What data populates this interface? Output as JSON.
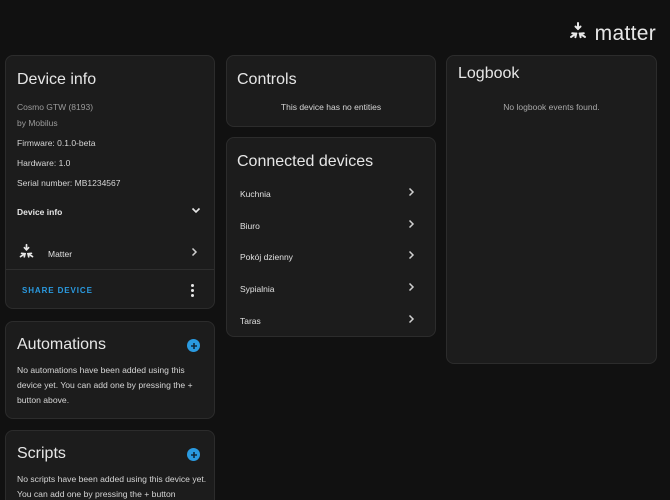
{
  "brand": {
    "name": "matter"
  },
  "device_info": {
    "title": "Device info",
    "model": "Cosmo GTW (8193)",
    "manufacturer": "by Mobilus",
    "firmware": "Firmware: 0.1.0-beta",
    "hardware": "Hardware: 1.0",
    "serial": "Serial number: MB1234567",
    "section_label": "Device info",
    "integration": "Matter",
    "share_label": "SHARE DEVICE"
  },
  "controls": {
    "title": "Controls",
    "empty_text": "This device has no entities"
  },
  "connected": {
    "title": "Connected devices",
    "items": [
      "Kuchnia",
      "Biuro",
      "Pokój dzienny",
      "Sypialnia",
      "Taras"
    ]
  },
  "logbook": {
    "title": "Logbook",
    "empty_text": "No logbook events found."
  },
  "automations": {
    "title": "Automations",
    "text": "No automations have been added using this device yet. You can add one by pressing the + button above."
  },
  "scripts": {
    "title": "Scripts",
    "text": "No scripts have been added using this device yet. You can add one by pressing the + button"
  },
  "colors": {
    "background": "#111111",
    "card": "#1c1c1c",
    "accent": "#2a9ae0"
  }
}
